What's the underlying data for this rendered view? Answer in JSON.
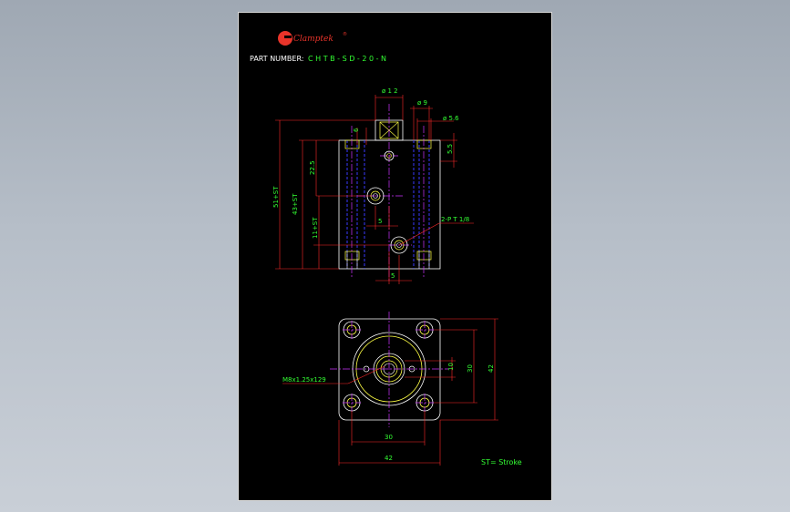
{
  "brand": {
    "name": "Clamptek",
    "mark": "®",
    "logo_letter": "C"
  },
  "part_number": {
    "label": "PART NUMBER:",
    "value": "C H T B - S D - 2 0 - N"
  },
  "dimensions": {
    "d12": "ø 1 2",
    "d9": "ø 9",
    "d56": "ø 5.6",
    "dim6": "6",
    "dim55": "5.5",
    "dim225": "22.5",
    "dim51st": "51+ST",
    "dim43st": "43+ST",
    "dim11st": "11+ST",
    "dim5a": "5",
    "dim5b": "5",
    "port": "2-P T 1/8",
    "thread": "M8x1.25x129",
    "dim10": "10",
    "dim30v": "30",
    "dim42v": "42",
    "dim30h": "30",
    "dim42h": "42"
  },
  "note": "ST= Stroke",
  "colors": {
    "outline": "#ffffff",
    "dimension": "#ff2a2a",
    "center": "#cc33ff",
    "hidden": "#3a3aff",
    "text": "#33ff33",
    "yellow": "#ffff44",
    "logo": "#e8342a"
  }
}
